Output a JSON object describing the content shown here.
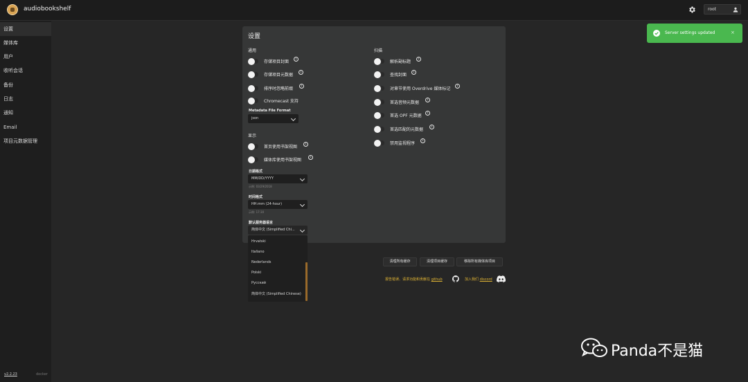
{
  "header": {
    "app_title": "audiobookshelf",
    "user": "root"
  },
  "sidebar": {
    "items": [
      "设置",
      "媒体库",
      "用户",
      "收听会话",
      "备份",
      "日志",
      "通知",
      "Email",
      "项目元数据管理"
    ],
    "active": 0,
    "version": "v2.2.23",
    "version_extra": "docker"
  },
  "settings": {
    "title": "设置",
    "general": {
      "heading": "通用",
      "toggles": [
        "存储项目封面",
        "存储项目元数据",
        "排序时忽略前缀",
        "Chromecast 支持"
      ],
      "metadata_format_label": "Metadata File Format",
      "metadata_format_value": "json"
    },
    "display": {
      "heading": "显示",
      "toggles": [
        "首页使用书架视图",
        "媒体库使用书架视图"
      ],
      "date_format_label": "日期格式",
      "date_format_value": "MM/DD/YYYY",
      "date_format_hint": "示例: 03/29/2018",
      "time_format_label": "时间格式",
      "time_format_value": "HH:mm (24-hour)",
      "time_format_hint": "示例: 17:30",
      "language_label": "默认服务器语言",
      "language_value": "简体中文 (Simplified Chi...",
      "language_options": [
        "Hrvatski",
        "Italiano",
        "Nederlands",
        "Polski",
        "Русский",
        "简体中文 (Simplified Chinese)"
      ]
    },
    "scanner": {
      "heading": "扫描",
      "toggles": [
        "解析副标题",
        "查找封面",
        "对章节使用 Overdrive 媒体标记",
        "首选音频元数据",
        "首选 OPF 元数据",
        "首选匹配的元数据",
        "禁用监视程序"
      ]
    }
  },
  "actions": {
    "purge_cache": "清理所有缓存",
    "purge_items_cache": "清理项目缓存",
    "remove_all_items": "移除所有媒体库项目",
    "report_text": "报告错误、请求功能和贡献在",
    "report_link": "github",
    "discord_text": "加入我们",
    "discord_link": "discord"
  },
  "toast": {
    "message": "Server settings updated",
    "close": "×"
  },
  "watermark": {
    "text": "Panda不是猫"
  },
  "colors": {
    "accent": "#e0b434",
    "toast": "#4ab84f",
    "scrollbar": "#9a6a2a"
  }
}
